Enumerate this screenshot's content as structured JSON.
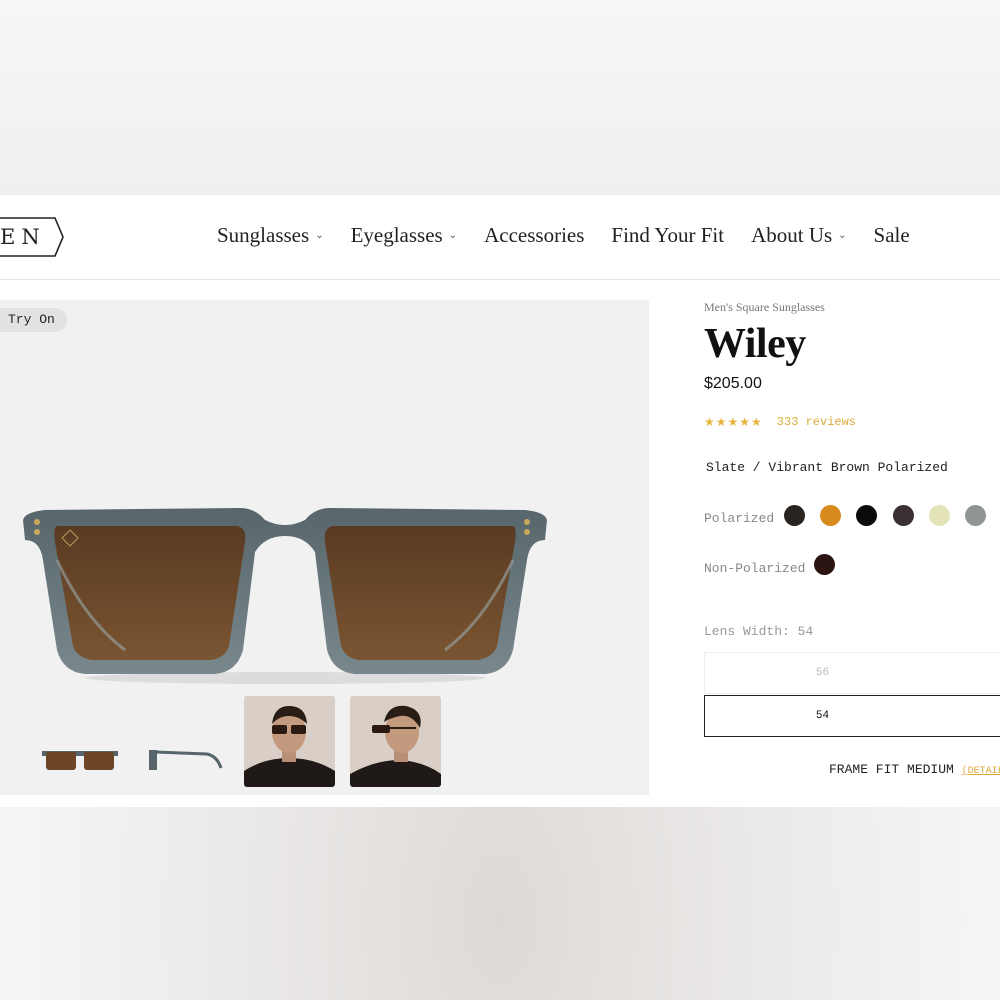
{
  "brand": {
    "logo_text": "EN"
  },
  "nav": {
    "items": [
      {
        "label": "Sunglasses",
        "has_dropdown": true
      },
      {
        "label": "Eyeglasses",
        "has_dropdown": true
      },
      {
        "label": "Accessories",
        "has_dropdown": false
      },
      {
        "label": "Find Your Fit",
        "has_dropdown": false
      },
      {
        "label": "About Us",
        "has_dropdown": true
      },
      {
        "label": "Sale",
        "has_dropdown": false
      }
    ],
    "chevron": "⌄"
  },
  "gallery": {
    "try_on_label": "Try On"
  },
  "product": {
    "category": "Men's Square Sunglasses",
    "name": "Wiley",
    "price": "$205.00",
    "stars": "★★★★★",
    "reviews": "333 reviews",
    "color_name": "Slate / Vibrant Brown Polarized",
    "polarized_label": "Polarized",
    "non_polarized_label": "Non-Polarized",
    "polarized_swatches": [
      "#2a2420",
      "#d98a1c",
      "#0b0b0b",
      "#3a2f33",
      "#e4e3b8",
      "#8f9595"
    ],
    "non_polarized_swatches": [
      "#2c1412"
    ],
    "lens_width_label": "Lens Width: 54",
    "sizes": [
      "56",
      "54"
    ],
    "selected_size": "54",
    "frame_fit": "FRAME FIT MEDIUM",
    "details_link": "DETAIL"
  },
  "colors": {
    "accent": "#e0a83a",
    "frame": "#55656a",
    "lens": "#6b4526"
  }
}
